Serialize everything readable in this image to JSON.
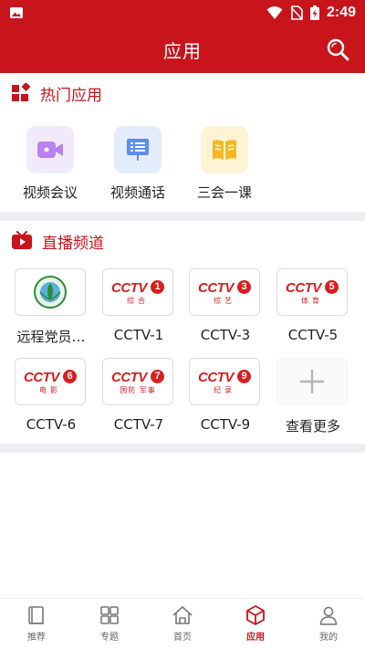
{
  "status_bar": {
    "time": "2:49"
  },
  "header": {
    "title": "应用"
  },
  "hot_section": {
    "title": "热门应用",
    "apps": [
      {
        "label": "视频会议",
        "icon": "video-camera-icon",
        "tile_color": "#f1eafc",
        "icon_color": "#b982f0"
      },
      {
        "label": "视频通话",
        "icon": "presentation-board-icon",
        "tile_color": "#e3ecfb",
        "icon_color": "#5b8ff0"
      },
      {
        "label": "三会一课",
        "icon": "open-book-icon",
        "tile_color": "#fff3d6",
        "icon_color": "#f4b823"
      }
    ]
  },
  "live_section": {
    "title": "直播频道",
    "channels": [
      {
        "label": "远程党员…",
        "logo": "emblem"
      },
      {
        "label": "CCTV-1",
        "logo_num": "1",
        "logo_sub": "综合"
      },
      {
        "label": "CCTV-3",
        "logo_num": "3",
        "logo_sub": "综艺"
      },
      {
        "label": "CCTV-5",
        "logo_num": "5",
        "logo_sub": "体育"
      },
      {
        "label": "CCTV-6",
        "logo_num": "6",
        "logo_sub": "电影"
      },
      {
        "label": "CCTV-7",
        "logo_num": "7",
        "logo_sub": "国防 军事"
      },
      {
        "label": "CCTV-9",
        "logo_num": "9",
        "logo_sub": "纪录"
      },
      {
        "label": "查看更多",
        "logo": "plus"
      }
    ]
  },
  "bottom_nav": {
    "items": [
      {
        "label": "推荐",
        "icon": "book-icon"
      },
      {
        "label": "专题",
        "icon": "grid-icon"
      },
      {
        "label": "首页",
        "icon": "home-icon"
      },
      {
        "label": "应用",
        "icon": "cube-icon",
        "active": true
      },
      {
        "label": "我的",
        "icon": "person-icon"
      }
    ]
  },
  "colors": {
    "brand_red": "#c8141b",
    "divider": "#eeeef2"
  }
}
